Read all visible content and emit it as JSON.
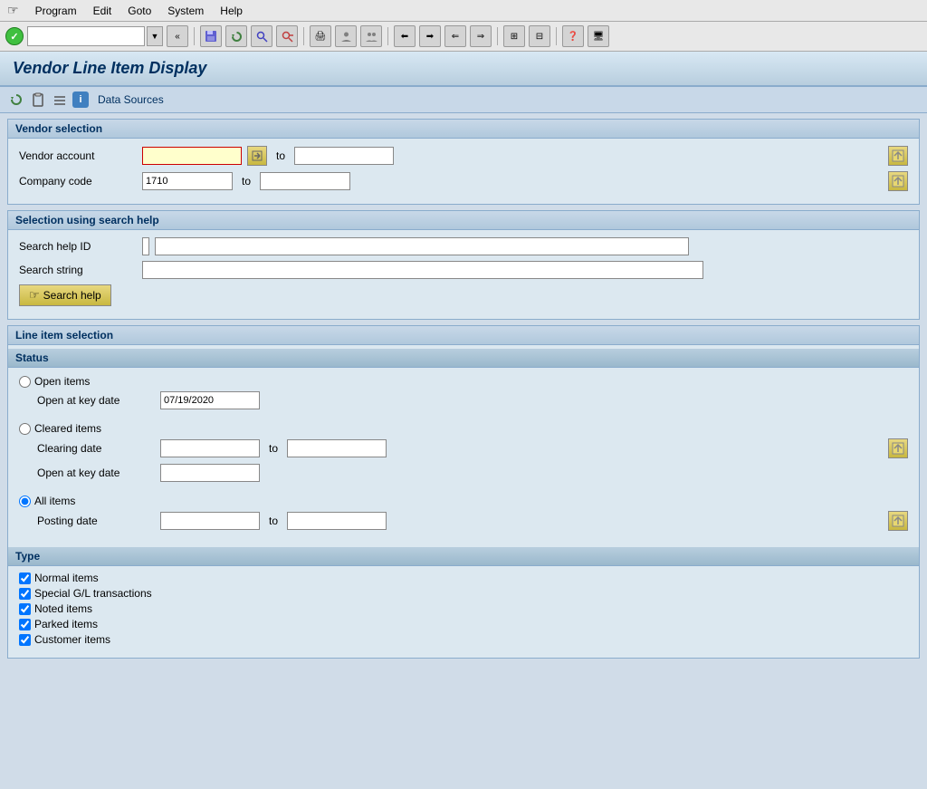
{
  "menubar": {
    "icon_label": "☰",
    "items": [
      {
        "label": "Program",
        "id": "menu-program"
      },
      {
        "label": "Edit",
        "id": "menu-edit"
      },
      {
        "label": "Goto",
        "id": "menu-goto"
      },
      {
        "label": "System",
        "id": "menu-system"
      },
      {
        "label": "Help",
        "id": "menu-help"
      }
    ]
  },
  "toolbar": {
    "dropdown_placeholder": "",
    "buttons": [
      "«",
      "💾",
      "🔄",
      "🔄",
      "⊗",
      "🖨",
      "👤",
      "👤",
      "⬅",
      "➡",
      "⬅",
      "➡",
      "⊞",
      "⊟",
      "❓",
      "🖥"
    ]
  },
  "page": {
    "title": "Vendor Line Item Display"
  },
  "sub_toolbar": {
    "buttons": [
      "🔄",
      "📋",
      "≡",
      "ℹ"
    ],
    "data_sources_label": "Data Sources"
  },
  "vendor_selection": {
    "section_title": "Vendor selection",
    "vendor_account_label": "Vendor account",
    "vendor_account_value": "",
    "vendor_account_to_value": "",
    "company_code_label": "Company code",
    "company_code_value": "1710",
    "company_code_to_value": "",
    "to_label": "to"
  },
  "search_help": {
    "section_title": "Selection using search help",
    "search_help_id_label": "Search help ID",
    "search_help_id_value": "",
    "search_string_label": "Search string",
    "search_string_value": "",
    "button_label": "Search help"
  },
  "line_item_selection": {
    "section_title": "Line item selection",
    "status_label": "Status",
    "open_items_label": "Open items",
    "open_at_key_date_label": "Open at key date",
    "open_at_key_date_value": "07/19/2020",
    "cleared_items_label": "Cleared items",
    "clearing_date_label": "Clearing date",
    "clearing_date_value": "",
    "clearing_date_to_value": "",
    "open_at_key_date2_label": "Open at key date",
    "open_at_key_date2_value": "",
    "all_items_label": "All items",
    "posting_date_label": "Posting date",
    "posting_date_value": "",
    "posting_date_to_value": "",
    "to_label": "to"
  },
  "type_section": {
    "section_title": "Type",
    "normal_items_label": "Normal items",
    "normal_items_checked": true,
    "special_gl_label": "Special G/L transactions",
    "special_gl_checked": true,
    "noted_items_label": "Noted items",
    "noted_items_checked": true,
    "parked_items_label": "Parked items",
    "parked_items_checked": true,
    "customer_items_label": "Customer items",
    "customer_items_checked": true
  }
}
